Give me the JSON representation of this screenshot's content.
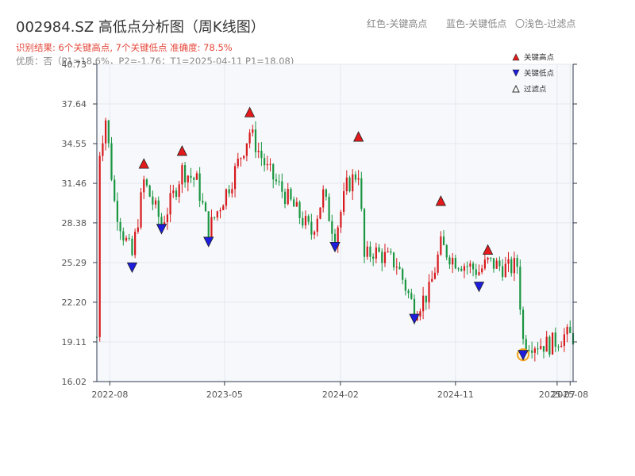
{
  "header": {
    "title": "002984.SZ 高低点分析图（周K线图）",
    "result_line": "识别结果: 6个关键高点, 7个关键低点  准确度: 78.5%",
    "quality_line": "优质：否（P1=18.6%，P2=-1.76；T1=2025-04-11 P1=18.08)"
  },
  "top_legend": {
    "red": "红色-关键高点",
    "blue": "蓝色-关键低点",
    "light": "〇浅色-过滤点"
  },
  "colors": {
    "up": "#d7191c",
    "down": "#1a9641",
    "high_marker": "#e31a1c",
    "low_marker": "#1d1ddb",
    "filtered_ring": "#f5a623",
    "plot_bg": "#f6f8fb",
    "grid": "#e4e8ee",
    "axis": "#2f3b4c"
  },
  "chart_data": {
    "type": "candlestick",
    "ylim": [
      16.02,
      40.73
    ],
    "yticks": [
      "40.73",
      "37.64",
      "34.55",
      "31.46",
      "28.38",
      "25.29",
      "22.20",
      "19.11",
      "16.02"
    ],
    "xlim": [
      "2022-07-01",
      "2025-08-08"
    ],
    "xticks": [
      "2022-08",
      "2023-05",
      "2024-02",
      "2024-11",
      "2025-07",
      "2025-08"
    ],
    "legend": [
      {
        "label": "关键高点",
        "marker": "triangle-up",
        "color": "#e31a1c"
      },
      {
        "label": "关键低点",
        "marker": "triangle-down",
        "color": "#1d1ddb"
      },
      {
        "label": "过滤点",
        "marker": "triangle-up-hollow",
        "color": "#333333"
      }
    ],
    "key_highs": [
      {
        "date": "2022-10-21",
        "price": 33.0
      },
      {
        "date": "2023-01-20",
        "price": 34.0
      },
      {
        "date": "2023-06-30",
        "price": 37.0
      },
      {
        "date": "2024-03-15",
        "price": 35.1
      },
      {
        "date": "2024-09-27",
        "price": 30.1
      },
      {
        "date": "2025-01-17",
        "price": 26.3
      }
    ],
    "key_lows": [
      {
        "date": "2022-09-23",
        "price": 24.9
      },
      {
        "date": "2022-12-02",
        "price": 27.9
      },
      {
        "date": "2023-03-24",
        "price": 26.9
      },
      {
        "date": "2024-01-19",
        "price": 26.5
      },
      {
        "date": "2024-07-26",
        "price": 20.9
      },
      {
        "date": "2024-12-27",
        "price": 23.4
      },
      {
        "date": "2025-04-11",
        "price": 18.08
      }
    ],
    "filtered_points": [
      {
        "date": "2025-04-11",
        "price": 18.08
      }
    ],
    "anchors": [
      {
        "date": "2022-07-08",
        "price": 34.0
      },
      {
        "date": "2022-07-22",
        "price": 36.5
      },
      {
        "date": "2022-08-12",
        "price": 30.0
      },
      {
        "date": "2022-09-02",
        "price": 27.5
      },
      {
        "date": "2022-09-23",
        "price": 25.8
      },
      {
        "date": "2022-10-21",
        "price": 31.6
      },
      {
        "date": "2022-12-02",
        "price": 28.3
      },
      {
        "date": "2022-12-30",
        "price": 30.5
      },
      {
        "date": "2023-01-20",
        "price": 32.5
      },
      {
        "date": "2023-02-24",
        "price": 31.6
      },
      {
        "date": "2023-03-24",
        "price": 27.8
      },
      {
        "date": "2023-05-19",
        "price": 31.8
      },
      {
        "date": "2023-06-30",
        "price": 35.5
      },
      {
        "date": "2023-08-11",
        "price": 32.5
      },
      {
        "date": "2023-10-13",
        "price": 29.6
      },
      {
        "date": "2023-11-24",
        "price": 27.6
      },
      {
        "date": "2023-12-22",
        "price": 30.6
      },
      {
        "date": "2024-01-19",
        "price": 27.3
      },
      {
        "date": "2024-02-16",
        "price": 31.2
      },
      {
        "date": "2024-03-15",
        "price": 32.4
      },
      {
        "date": "2024-03-29",
        "price": 25.6
      },
      {
        "date": "2024-04-19",
        "price": 26.2
      },
      {
        "date": "2024-06-14",
        "price": 25.2
      },
      {
        "date": "2024-07-26",
        "price": 21.6
      },
      {
        "date": "2024-08-30",
        "price": 23.0
      },
      {
        "date": "2024-09-27",
        "price": 26.6
      },
      {
        "date": "2024-10-25",
        "price": 25.6
      },
      {
        "date": "2024-12-27",
        "price": 24.6
      },
      {
        "date": "2025-01-17",
        "price": 25.3
      },
      {
        "date": "2025-03-07",
        "price": 24.8
      },
      {
        "date": "2025-03-28",
        "price": 25.1
      },
      {
        "date": "2025-04-11",
        "price": 19.2
      },
      {
        "date": "2025-05-09",
        "price": 19.0
      },
      {
        "date": "2025-06-13",
        "price": 18.9
      },
      {
        "date": "2025-07-18",
        "price": 19.6
      },
      {
        "date": "2025-08-08",
        "price": 19.5
      }
    ]
  }
}
